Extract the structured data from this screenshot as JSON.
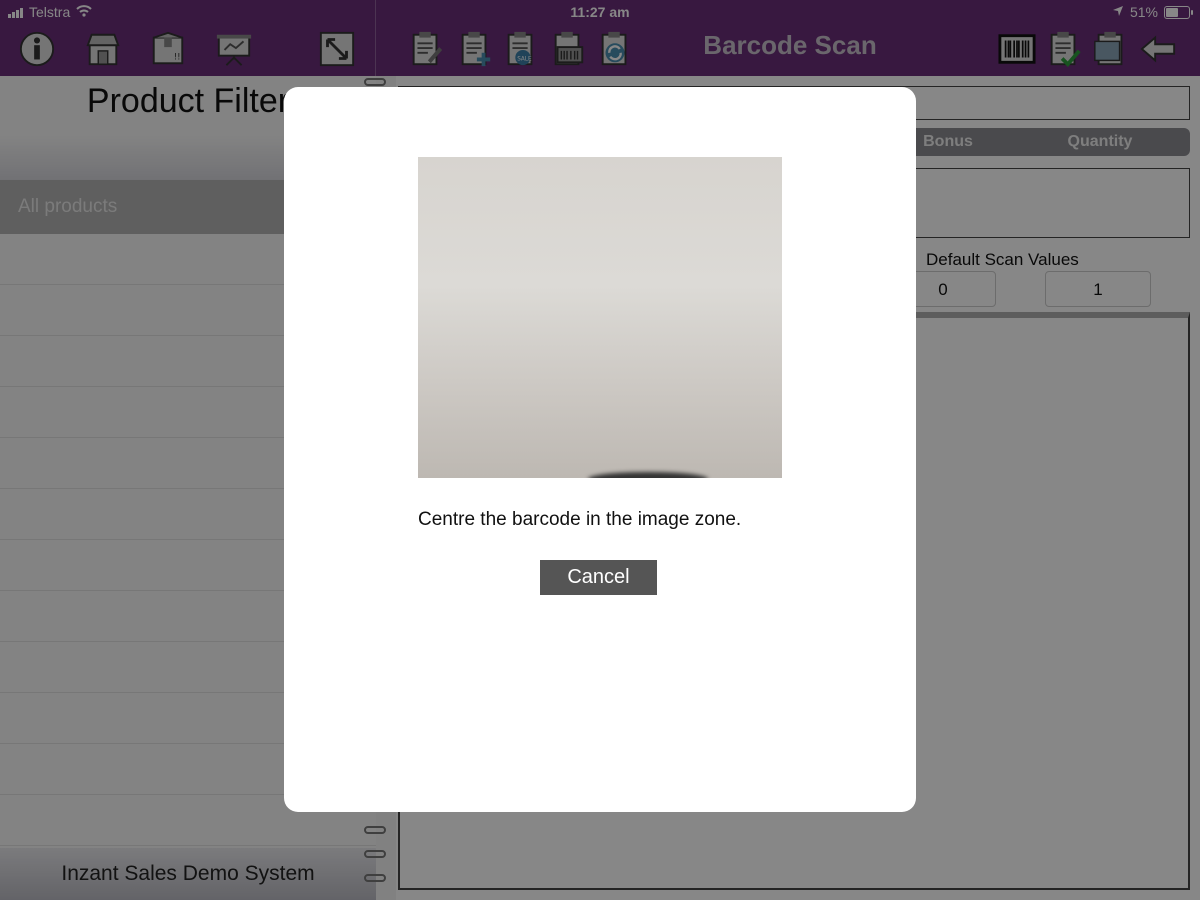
{
  "status": {
    "carrier": "Telstra",
    "time": "11:27 am",
    "battery": "51%"
  },
  "toolbar": {
    "title": "Barcode Scan",
    "left_icons": [
      "info-icon",
      "store-icon",
      "package-icon",
      "presentation-icon",
      "expand-icon"
    ],
    "center_icons": [
      "edit-document-icon",
      "add-document-icon",
      "sale-document-icon",
      "print-document-icon",
      "sync-document-icon"
    ],
    "right_icons": [
      "barcode-icon",
      "approve-document-icon",
      "clipboard-icon",
      "back-arrow-icon"
    ],
    "colors": {
      "bar": "#6b2f7a",
      "title": "#c9c0cc"
    }
  },
  "left_panel": {
    "title": "Product Filter",
    "selected_item": "All products",
    "footer": "Inzant Sales Demo System"
  },
  "right_panel": {
    "columns": {
      "bonus": "Bonus",
      "quantity": "Quantity"
    },
    "default_scan_label": "Default Scan Values",
    "default_bonus": "0",
    "default_quantity": "1"
  },
  "modal": {
    "message": "Centre the barcode in the image zone.",
    "cancel_label": "Cancel"
  }
}
